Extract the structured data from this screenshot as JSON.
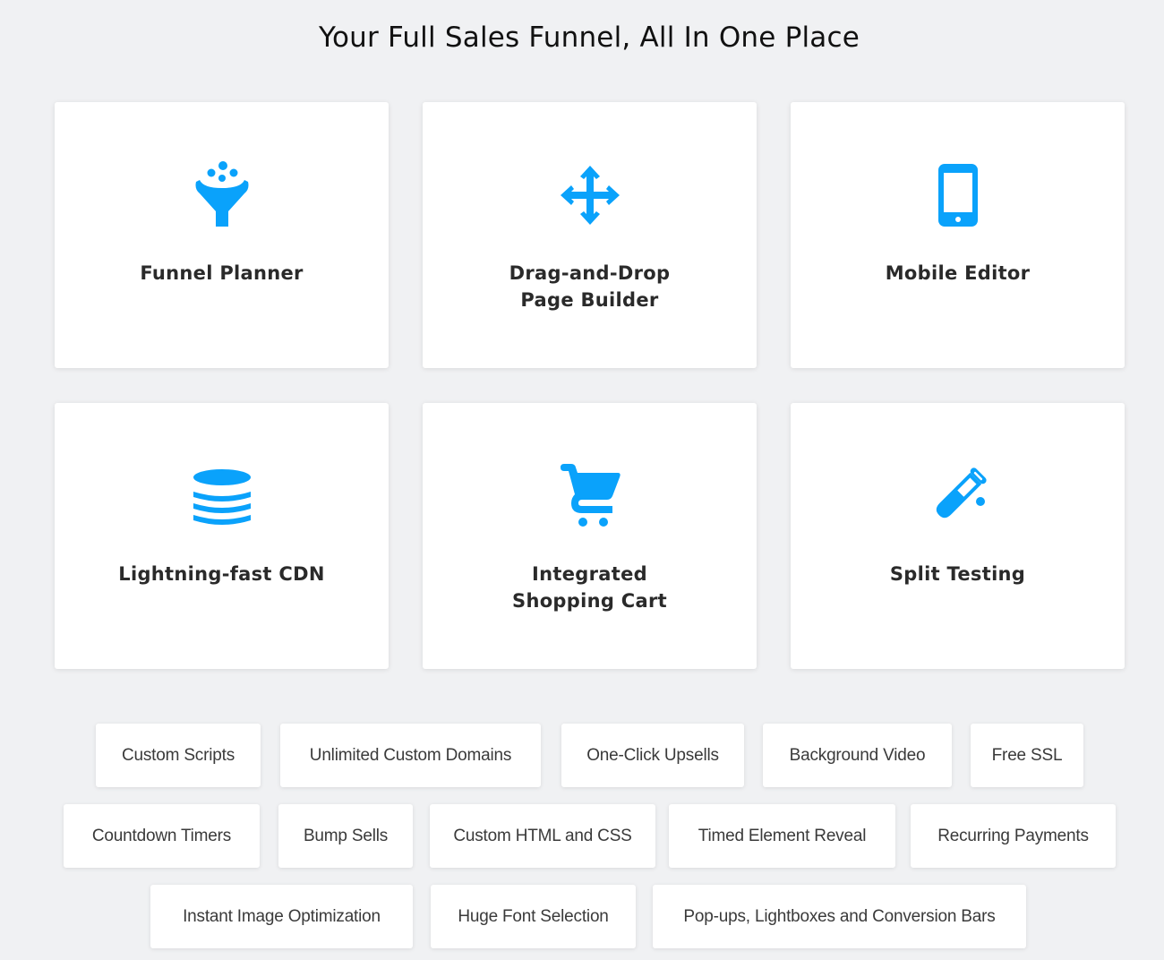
{
  "heading": "Your Full Sales Funnel, All In One Place",
  "accent_color": "#0aa2fb",
  "features": [
    {
      "label": "Funnel Planner",
      "icon": "funnel-icon"
    },
    {
      "label": "Drag-and-Drop\nPage Builder",
      "icon": "move-arrows-icon"
    },
    {
      "label": "Mobile Editor",
      "icon": "mobile-phone-icon"
    },
    {
      "label": "Lightning-fast CDN",
      "icon": "database-icon"
    },
    {
      "label": "Integrated\nShopping Cart",
      "icon": "shopping-cart-icon"
    },
    {
      "label": "Split Testing",
      "icon": "test-tube-icon"
    }
  ],
  "tags": [
    "Custom Scripts",
    "Unlimited Custom Domains",
    "One-Click Upsells",
    "Background Video",
    "Free SSL",
    "Countdown Timers",
    "Bump Sells",
    "Custom HTML and CSS",
    "Timed Element Reveal",
    "Recurring Payments",
    "Instant Image Optimization",
    "Huge Font Selection",
    "Pop-ups, Lightboxes and Conversion Bars"
  ]
}
